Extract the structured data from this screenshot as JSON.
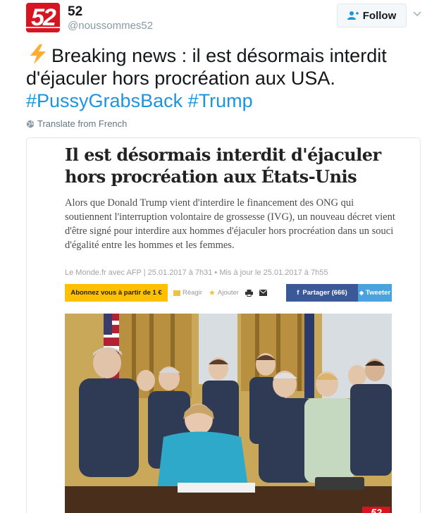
{
  "account": {
    "name": "52",
    "handle": "@noussommes52",
    "avatar_text": "52",
    "brand_color": "#d7141f"
  },
  "follow_button": {
    "label": "Follow",
    "icon": "add-user-icon"
  },
  "tweet": {
    "line1": "Breaking news : il est désormais interdit",
    "line2": "d'éjaculer hors procréation aux USA.",
    "hashtags": [
      "#PussyGrabsBack",
      "#Trump"
    ],
    "emoji": "lightning-bolt-icon",
    "hashtag_color": "#1b95e0"
  },
  "translate": {
    "label": "Translate from French",
    "icon": "globe-icon"
  },
  "article": {
    "title": "Il est désormais interdit d'éjaculer hors procréation aux États-Unis",
    "lede": "Alors que Donald Trump vient d'interdire le financement des ONG qui soutiennent l'interruption volontaire de grossesse (IVG), un nouveau décret vient d'être signé pour interdire aux hommes d'éjaculer hors procréation dans un souci d'égalité entre les hommes et les femmes.",
    "byline": "Le Monde.fr avec AFP | 25.01.2017 à 7h31 • Mis à jour le 25.01.2017 à 7h55",
    "toolbar": {
      "subscribe": "Abonnez vous à partir de 1 €",
      "react": "Réagir",
      "add": "Ajouter",
      "facebook": "Partager (666)",
      "twitter": "Tweeter",
      "facebook_color": "#3b5998",
      "twitter_color": "#4aa3df",
      "subscribe_color": "#ffc000"
    },
    "photo_badge": "52"
  }
}
